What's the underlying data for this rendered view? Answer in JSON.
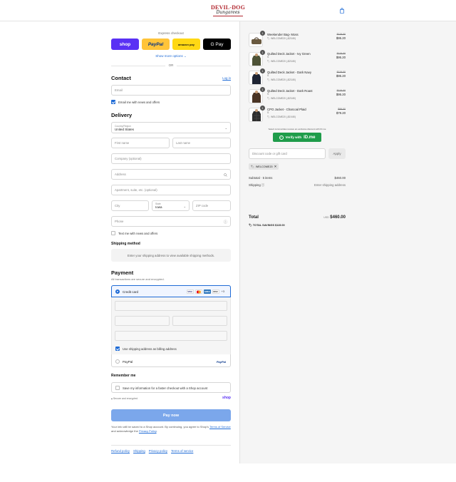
{
  "brand": {
    "line1": "DEVIL-DOG",
    "line2": "Dungarees"
  },
  "express": {
    "title": "Express checkout",
    "buttons": {
      "shop": "shop",
      "paypal": "PayPal",
      "amazon": "amazon pay",
      "gpay": "G Pay"
    },
    "show_more": "Show more options ⌄",
    "or": "OR"
  },
  "contact": {
    "heading": "Contact",
    "login": "Log in",
    "email_placeholder": "Email",
    "news_label": "Email me with news and offers",
    "news_checked": true
  },
  "delivery": {
    "heading": "Delivery",
    "country_label": "Country/Region",
    "country_value": "United States",
    "first_name": "First name",
    "last_name": "Last name",
    "company": "Company (optional)",
    "address": "Address",
    "apartment": "Apartment, suite, etc. (optional)",
    "city": "City",
    "state_label": "State",
    "state_value": "Iowa",
    "zip": "ZIP code",
    "phone": "Phone",
    "text_label": "Text me with news and offers"
  },
  "shipping_method": {
    "heading": "Shipping method",
    "note": "Enter your shipping address to view available shipping methods."
  },
  "payment": {
    "heading": "Payment",
    "subtitle": "All transactions are secure and encrypted.",
    "credit_card": "Credit card",
    "card_logos": [
      "VISA",
      "MC",
      "AMEX",
      "DISC"
    ],
    "more_cards": "+3",
    "billing_label": "Use shipping address as billing address",
    "paypal": "PayPal"
  },
  "remember": {
    "heading": "Remember me",
    "label": "Save my information for a faster checkout with a Shop account",
    "secure": "Secure and encrypted",
    "shop": "shop"
  },
  "pay_now": "Pay now",
  "legal": {
    "text1": "Your info will be saved to a Shop account. By continuing, you agree to Shop's",
    "tos": "Terms of Service",
    "text2": "and acknowledge the",
    "privacy": "Privacy Policy",
    "end": "."
  },
  "footer_links": [
    "Refund policy",
    "Shipping",
    "Privacy policy",
    "Terms of service"
  ],
  "summary": {
    "items": [
      {
        "name": "Weekender Bag- Moss",
        "variant": "",
        "discount": "WELCOME20 (-$23.80)",
        "old": "$119.00",
        "new": "$95.20",
        "qty": "1"
      },
      {
        "name": "Quilted Deck Jacket - Ivy Green",
        "variant": "S",
        "discount": "WELCOME20 (-$23.80)",
        "old": "$119.00",
        "new": "$95.20",
        "qty": "1"
      },
      {
        "name": "Quilted Deck Jacket - Dark Navy",
        "variant": "S",
        "discount": "WELCOME20 (-$23.80)",
        "old": "$119.00",
        "new": "$95.20",
        "qty": "1"
      },
      {
        "name": "Quilted Deck Jacket - Dark Roast",
        "variant": "S",
        "discount": "WELCOME20 (-$23.80)",
        "old": "$119.00",
        "new": "$95.20",
        "qty": "1"
      },
      {
        "name": "CPO Jacket - Charcoal Plaid",
        "variant": "S",
        "discount": "WELCOME20 (-$19.80)",
        "old": "$99.00",
        "new": "$79.20",
        "qty": "1"
      }
    ],
    "verify_note": "Select communities receive an exclusive discount with ID.me",
    "verify_label": "Verify with",
    "verify_brand": "ID.me",
    "discount_placeholder": "Discount code or gift card",
    "apply": "Apply",
    "tag": "WELCOME20",
    "subtotal_label": "Subtotal · 5 items",
    "subtotal_value": "$460.00",
    "shipping_label": "Shipping ⓘ",
    "shipping_value": "Enter shipping address",
    "total_label": "Total",
    "total_currency": "USD",
    "total_value": "$460.00",
    "savings": "TOTAL SAVINGS  $115.00"
  }
}
